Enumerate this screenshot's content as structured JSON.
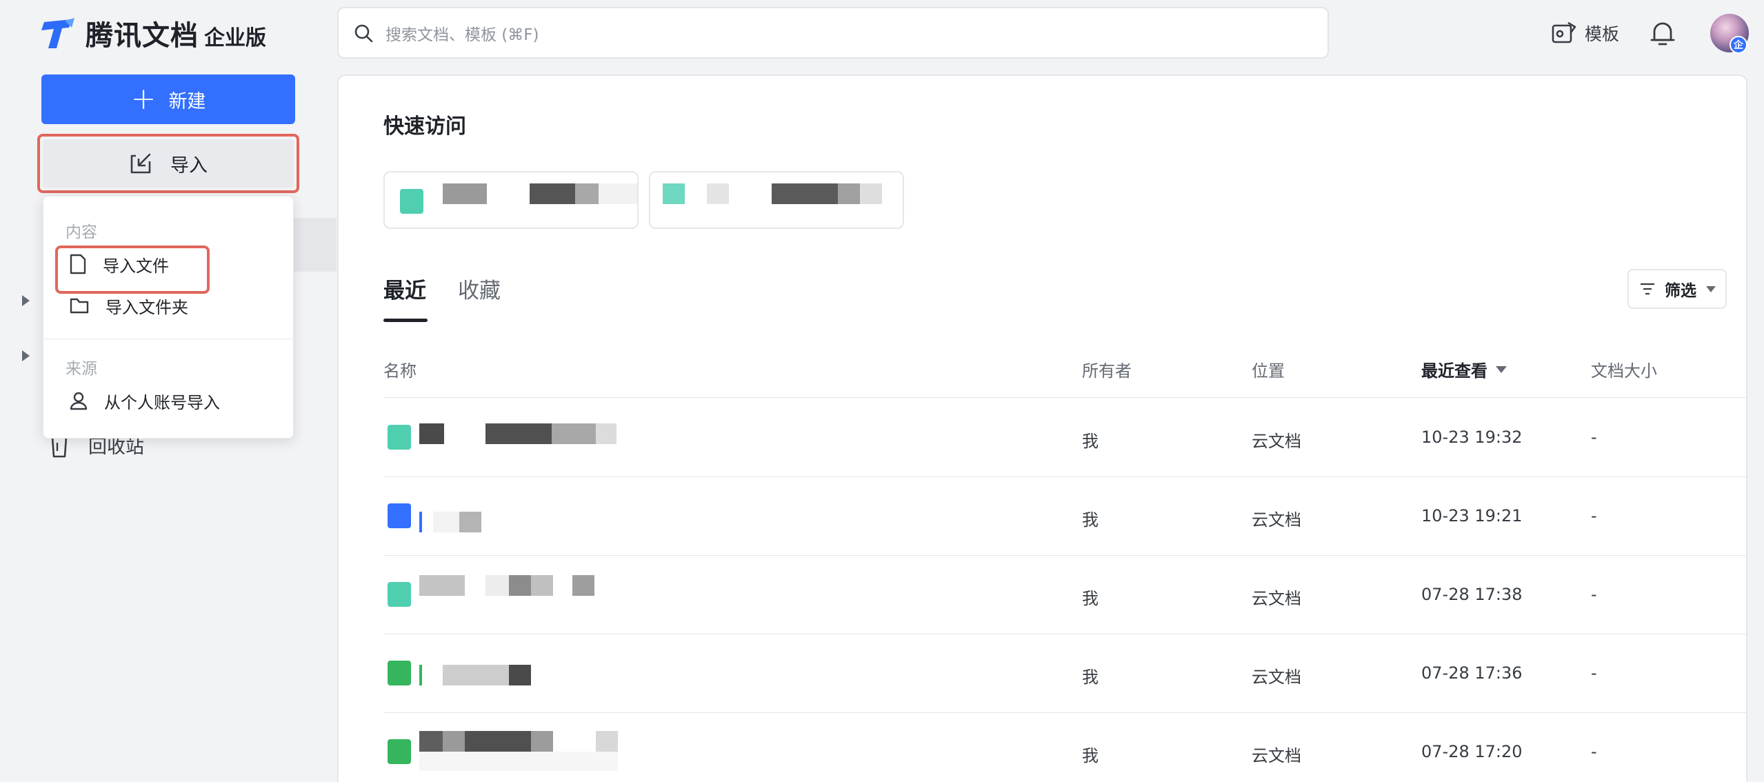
{
  "app": {
    "logo_text": "腾讯文档",
    "edition": "企业版"
  },
  "search": {
    "placeholder": "搜索文档、模板 (⌘F)"
  },
  "header": {
    "template_label": "模板",
    "avatar_badge": "企"
  },
  "sidebar": {
    "new_label": "新建",
    "import_label": "导入",
    "trash_label": "回收站"
  },
  "import_menu": {
    "content_group": "内容",
    "import_file": "导入文件",
    "import_folder": "导入文件夹",
    "source_group": "来源",
    "import_personal": "从个人账号导入"
  },
  "main": {
    "quick_access_title": "快速访问",
    "tabs": [
      "最近",
      "收藏"
    ],
    "filter_label": "筛选",
    "columns": {
      "name": "名称",
      "owner": "所有者",
      "location": "位置",
      "last_viewed": "最近查看",
      "size": "文档大小"
    },
    "rows": [
      {
        "type": "mindmap",
        "owner": "我",
        "location": "云文档",
        "last_viewed": "10-23 19:32",
        "size": "-"
      },
      {
        "type": "doc",
        "owner": "我",
        "location": "云文档",
        "last_viewed": "10-23 19:21",
        "size": "-"
      },
      {
        "type": "mindmap",
        "owner": "我",
        "location": "云文档",
        "last_viewed": "07-28 17:38",
        "size": "-"
      },
      {
        "type": "sheet",
        "owner": "我",
        "location": "云文档",
        "last_viewed": "07-28 17:36",
        "size": "-"
      },
      {
        "type": "sheet",
        "owner": "我",
        "location": "云文档",
        "last_viewed": "07-28 17:20",
        "size": "-"
      }
    ]
  },
  "colors": {
    "accent": "#3370ff",
    "highlight_outline": "#e0675c",
    "mindmap_icon": "#4fcfb0",
    "doc_icon": "#3370ff",
    "sheet_icon": "#34b55e"
  }
}
